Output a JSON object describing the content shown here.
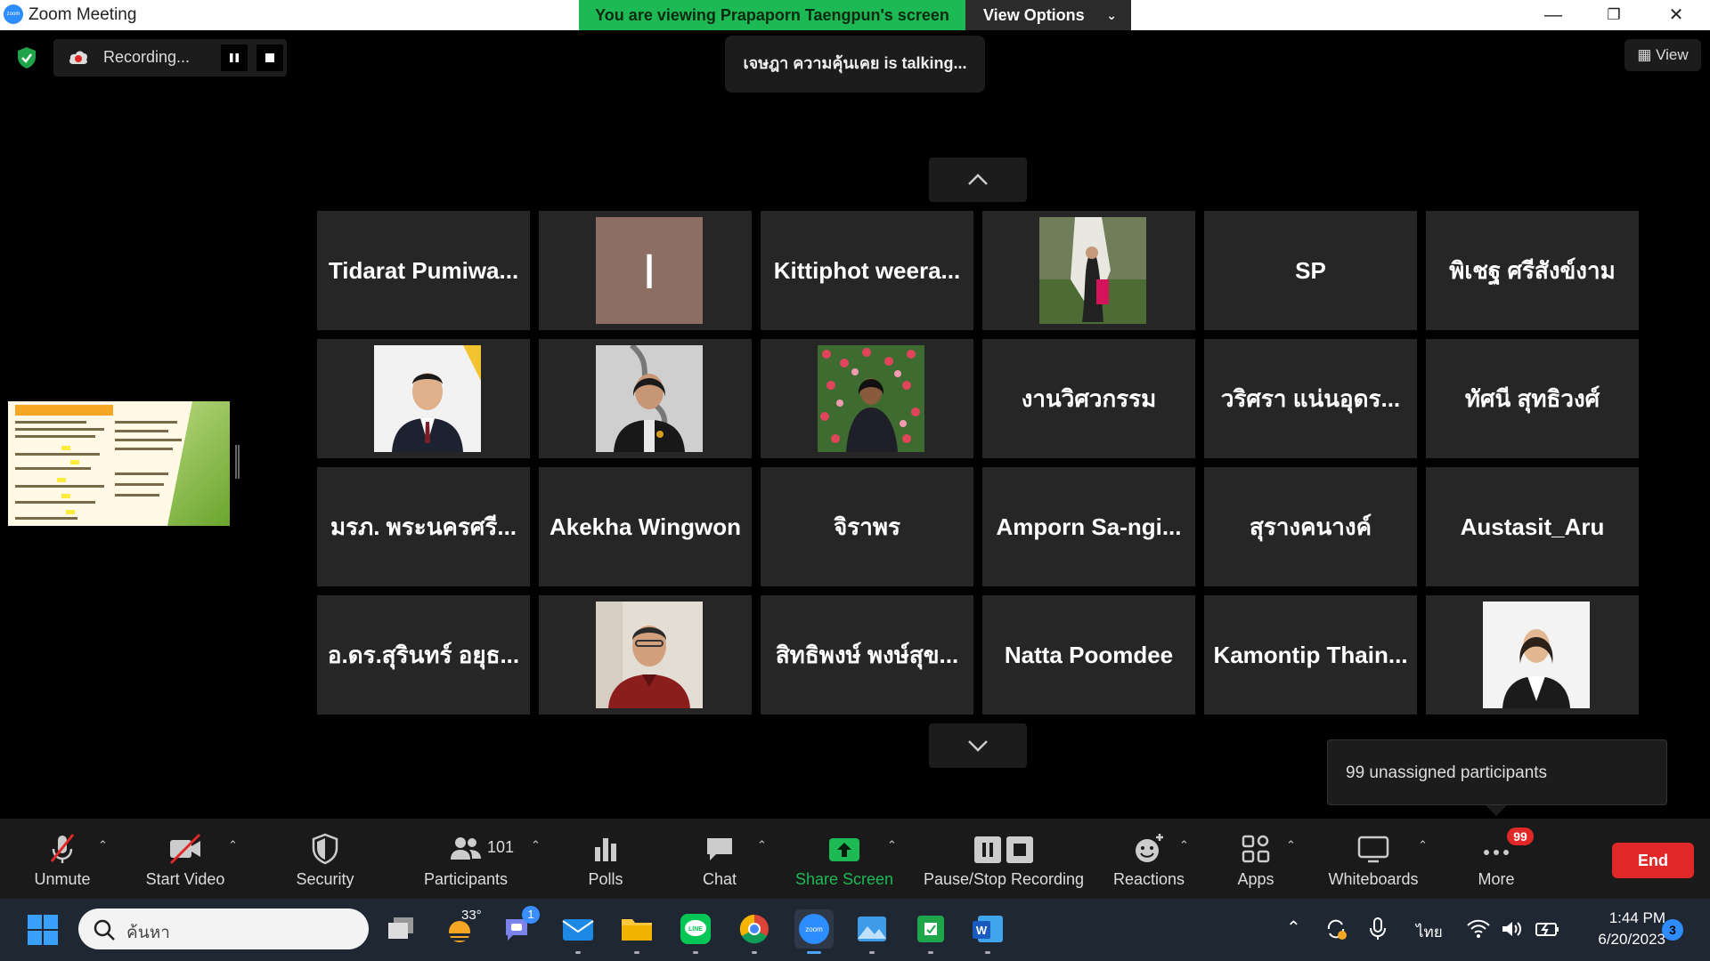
{
  "window": {
    "title": "Zoom Meeting",
    "app_icon_text": "zoom",
    "viewing_banner": "You are viewing Prapaporn Taengpun's screen",
    "view_options_label": "View Options",
    "minimize": "—",
    "maximize": "❐",
    "close": "✕"
  },
  "recording": {
    "status_label": "Recording..."
  },
  "talking_indicator": "เจษฎา ความคุ้นเคย is talking...",
  "view_button_label": "View",
  "gallery": {
    "tiles": [
      {
        "name": "Tidarat  Pumiwa...",
        "photo": ""
      },
      {
        "name": "",
        "photo": "initial",
        "initial": "I"
      },
      {
        "name": "Kittiphot  weera...",
        "photo": ""
      },
      {
        "name": "",
        "photo": "woman-garden"
      },
      {
        "name": "SP",
        "photo": ""
      },
      {
        "name": "พิเชฐ ศรีสังข์งาม",
        "photo": ""
      },
      {
        "name": "",
        "photo": "man-suit"
      },
      {
        "name": "",
        "photo": "woman-dna"
      },
      {
        "name": "",
        "photo": "woman-tulips"
      },
      {
        "name": "งานวิศวกรรม",
        "photo": ""
      },
      {
        "name": "วริศรา แน่นอุดร...",
        "photo": ""
      },
      {
        "name": "ทัศนี สุทธิวงศ์",
        "photo": ""
      },
      {
        "name": "มรภ. พระนครศรี...",
        "photo": ""
      },
      {
        "name": "Akekha Wingwon",
        "photo": ""
      },
      {
        "name": "จิราพร",
        "photo": ""
      },
      {
        "name": "Amporn  Sa-ngi...",
        "photo": ""
      },
      {
        "name": "สุรางคนางค์",
        "photo": ""
      },
      {
        "name": "Austasit_Aru",
        "photo": ""
      },
      {
        "name": "อ.ดร.สุรินทร์ อยุธ...",
        "photo": ""
      },
      {
        "name": "",
        "photo": "man-red"
      },
      {
        "name": "สิทธิพงษ์  พงษ์สุข...",
        "photo": ""
      },
      {
        "name": "Natta Poomdee",
        "photo": ""
      },
      {
        "name": "Kamontip  Thain...",
        "photo": ""
      },
      {
        "name": "",
        "photo": "woman-blazer"
      }
    ]
  },
  "tooltip": "99 unassigned participants",
  "toolbar": {
    "unmute": "Unmute",
    "start_video": "Start Video",
    "security": "Security",
    "participants": "Participants",
    "participants_count": "101",
    "polls": "Polls",
    "chat": "Chat",
    "share_screen": "Share Screen",
    "pause_stop_recording": "Pause/Stop Recording",
    "reactions": "Reactions",
    "apps": "Apps",
    "whiteboards": "Whiteboards",
    "more": "More",
    "more_badge": "99",
    "end": "End"
  },
  "taskbar": {
    "search_placeholder": "ค้นหา",
    "weather": "33°",
    "teams_badge": "1",
    "language": "ไทย",
    "time": "1:44 PM",
    "date": "6/20/2023",
    "notifications": "3"
  },
  "colors": {
    "share_green": "#1db954",
    "end_red": "#e02828",
    "tile_bg": "#262626",
    "taskbar_bg": "#1f2733"
  }
}
